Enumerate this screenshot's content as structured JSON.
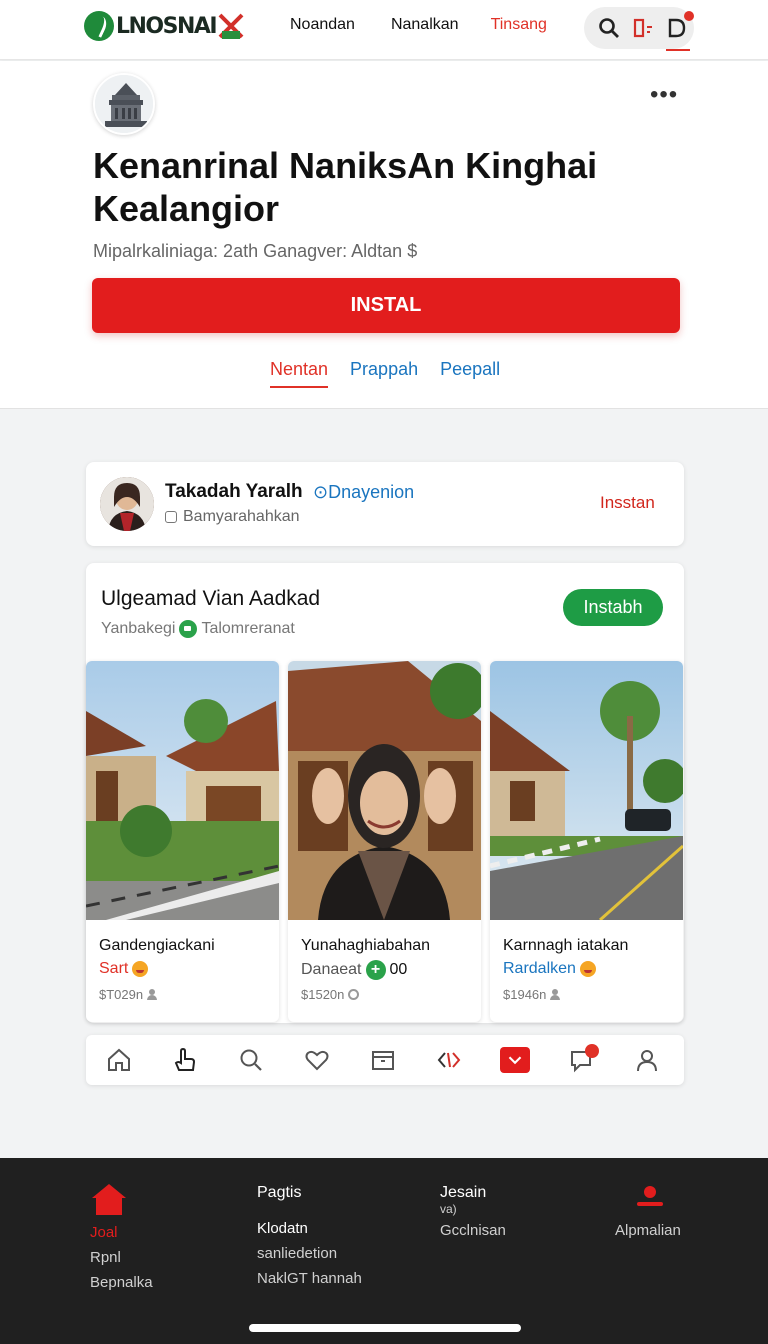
{
  "colors": {
    "accent_red": "#e21d1d",
    "link_blue": "#1a75bf",
    "green": "#1e9c45",
    "footer_bg": "#202020"
  },
  "topnav": {
    "logo_text": "LNOSNAI",
    "links": [
      "Noandan",
      "Nanalkan",
      "Tinsang"
    ],
    "tools": [
      "search-icon",
      "bookmark-icon",
      "notification-icon"
    ]
  },
  "header": {
    "title": "Kenanrinal NaniksAn Kinghai Kealangior",
    "subtitle": "Mipalrkaliniaga: 2ath  Ganagver: Aldtan $",
    "install_label": "INSTAL",
    "tabs": [
      "Nentan",
      "Prappah",
      "Peepall"
    ],
    "more_label": "•••"
  },
  "profile": {
    "name": "Takadah Yaralh",
    "tag": "⊙Dnayenion",
    "sub": "Bamyarahahkan",
    "action": "Insstan"
  },
  "gallery": {
    "title": "Ulgeamad Vian Aadkad",
    "sub_left": "Yanbakegi",
    "sub_right": "Talomreranat",
    "button": "Instabh",
    "tiles": [
      {
        "name": "Gandengiackani",
        "tag": "Sart",
        "tag_color": "#e03127",
        "meta": "$T029n"
      },
      {
        "name": "Yunahaghiabahan",
        "tag": "Danaeat",
        "tag_extra": "00",
        "tag_color": "#555555",
        "meta": "$1520n"
      },
      {
        "name": "Karnnagh iatakan",
        "tag": "Rardalken",
        "tag_color": "#1a75bf",
        "meta": "$1946n"
      }
    ]
  },
  "actionbar": {
    "items": [
      "home-icon",
      "hand-icon",
      "search-icon",
      "heart-icon",
      "inbox-icon",
      "share-arrows-icon",
      "dropdown-icon",
      "chat-icon",
      "profile-icon"
    ]
  },
  "footer": {
    "col1": {
      "title": "Joal",
      "lines": [
        "Rpnl",
        "Bepnalka"
      ]
    },
    "col2": {
      "title": "Pagtis",
      "lines": [
        "Klodatn",
        "sanliedetion",
        "NaklGT hannah"
      ]
    },
    "col3": {
      "title": "Jesain",
      "sub": "va)",
      "lines": [
        "Gcclnisan"
      ]
    },
    "col4": {
      "title": "Alpmalian"
    }
  }
}
